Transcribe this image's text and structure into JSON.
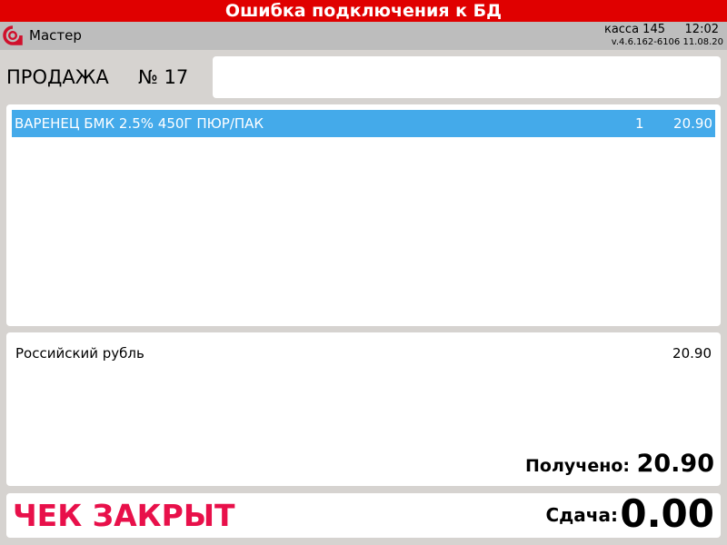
{
  "header": {
    "error_text": "Ошибка подключения к БД",
    "user_name": "Мастер",
    "kassa": "касса 145",
    "time": "12:02",
    "version": "v.4.6.162-6106  11.08.20"
  },
  "sale": {
    "label": "ПРОДАЖА",
    "number": "№ 17"
  },
  "items": [
    {
      "name": "ВАРЕНЕЦ БМК 2.5% 450Г ПЮР/ПАК",
      "qty": "1",
      "price": "20.90"
    }
  ],
  "payment": {
    "currency": "Российский рубль",
    "amount": "20.90",
    "received_label": "Получено:",
    "received_amount": "20.90"
  },
  "footer": {
    "status": "ЧЕК ЗАКРЫТ",
    "change_label": "Сдача:",
    "change_amount": "0.00"
  },
  "colors": {
    "error_banner": "#e00000",
    "selected_row": "#44aaea",
    "closed_status": "#e8104a",
    "logo": "#d0102c"
  }
}
